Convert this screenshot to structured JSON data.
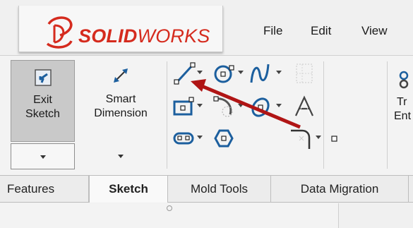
{
  "app": {
    "logo_solid": "SOLID",
    "logo_works": "WORKS"
  },
  "menu": [
    "File",
    "Edit",
    "View"
  ],
  "ribbon": {
    "exit_sketch_line1": "Exit",
    "exit_sketch_line2": "Sketch",
    "smart_dim_line1": "Smart",
    "smart_dim_line2": "Dimension",
    "trim_partial_line1": "Tr",
    "trim_partial_line2": "Ent"
  },
  "tabs": [
    {
      "label": "Features",
      "active": false
    },
    {
      "label": "Sketch",
      "active": true
    },
    {
      "label": "Mold Tools",
      "active": false
    },
    {
      "label": "Data Migration",
      "active": false
    }
  ],
  "icons": {
    "exit_sketch": "exit-sketch-icon",
    "smart_dimension": "smart-dimension-icon",
    "line": "line-icon",
    "circle": "circle-icon",
    "spline": "spline-icon",
    "rectangle": "rectangle-icon",
    "arc": "arc-icon",
    "ellipse": "ellipse-icon",
    "text": "text-icon",
    "slot": "slot-icon",
    "polygon": "polygon-icon",
    "fillet": "fillet-icon",
    "point": "point-icon"
  },
  "colors": {
    "brand_red": "#d52b1e",
    "icon_blue": "#1c5f9e",
    "annotation_arrow": "#b01515"
  }
}
